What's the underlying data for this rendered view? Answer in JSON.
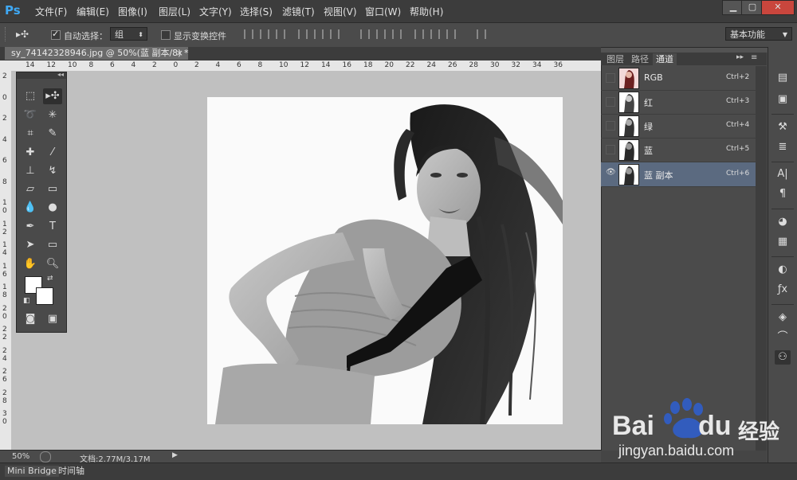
{
  "app": {
    "logo": "Ps"
  },
  "menu": [
    "文件(F)",
    "编辑(E)",
    "图像(I)",
    "图层(L)",
    "文字(Y)",
    "选择(S)",
    "滤镜(T)",
    "视图(V)",
    "窗口(W)",
    "帮助(H)"
  ],
  "window_controls": {
    "minimize": "▁",
    "maximize": "▢",
    "close": "✕"
  },
  "options": {
    "tool_icon": "move-tool-icon",
    "auto_select_label": "自动选择：",
    "auto_select_checked": true,
    "auto_select_value": "组",
    "show_transform_label": "显示变换控件",
    "workspace": "基本功能"
  },
  "document": {
    "tab_title": "sy_74142328946.jpg @ 50%(蓝 副本/8) *",
    "tab_close": "×"
  },
  "ruler_top": [
    "14",
    "12",
    "10",
    "8",
    "6",
    "4",
    "2",
    "0",
    "2",
    "4",
    "6",
    "8",
    "10",
    "12",
    "14",
    "16",
    "18",
    "20",
    "22",
    "24",
    "26",
    "28",
    "30",
    "32",
    "34",
    "36"
  ],
  "ruler_left": [
    "2",
    "0",
    "2",
    "4",
    "6",
    "8",
    "1 0",
    "1 2",
    "1 4",
    "1 6",
    "1 8",
    "2 0",
    "2 2",
    "2 4",
    "2 6",
    "2 8",
    "3 0"
  ],
  "status": {
    "zoom": "50%",
    "doc_info": "文档:2.77M/3.17M"
  },
  "bottom_tabs": [
    "Mini Bridge",
    "时间轴"
  ],
  "channels_panel": {
    "tabs": [
      "图层",
      "路径",
      "通道"
    ],
    "active_tab": "通道",
    "channels": [
      {
        "name": "RGB",
        "shortcut": "Ctrl+2",
        "selected": false,
        "visible": false
      },
      {
        "name": "红",
        "shortcut": "Ctrl+3",
        "selected": false,
        "visible": false
      },
      {
        "name": "绿",
        "shortcut": "Ctrl+4",
        "selected": false,
        "visible": false
      },
      {
        "name": "蓝",
        "shortcut": "Ctrl+5",
        "selected": false,
        "visible": false
      },
      {
        "name": "蓝 副本",
        "shortcut": "Ctrl+6",
        "selected": true,
        "visible": true
      }
    ]
  },
  "watermark": {
    "brand_a": "Bai",
    "brand_b": "du",
    "brand_cn": "经验",
    "url": "jingyan.baidu.com"
  },
  "colors": {
    "accent_ps": "#3fa9f5",
    "selected_row": "#5b6a80",
    "watermark_blue": "#2e5fd1"
  }
}
